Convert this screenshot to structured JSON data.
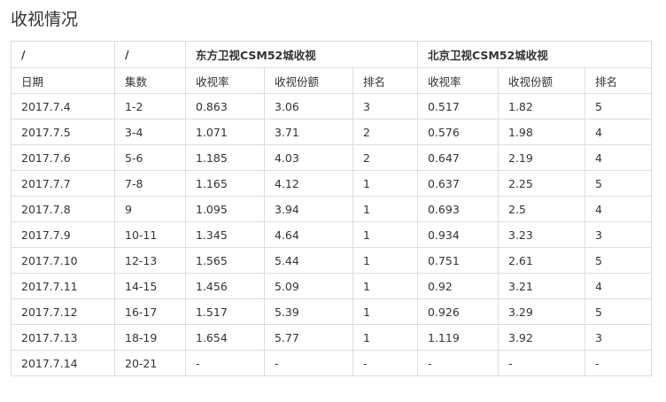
{
  "page": {
    "title": "收视情况"
  },
  "table": {
    "group_header": [
      "/",
      "/",
      "东方卫视CSM52城收视",
      "北京卫视CSM52城收视"
    ],
    "columns": [
      "日期",
      "集数",
      "收视率",
      "收视份额",
      "排名",
      "收视率",
      "收视份额",
      "排名"
    ],
    "rows": [
      [
        "2017.7.4",
        "1-2",
        "0.863",
        "3.06",
        "3",
        "0.517",
        "1.82",
        "5"
      ],
      [
        "2017.7.5",
        "3-4",
        "1.071",
        "3.71",
        "2",
        "0.576",
        "1.98",
        "4"
      ],
      [
        "2017.7.6",
        "5-6",
        "1.185",
        "4.03",
        "2",
        "0.647",
        "2.19",
        "4"
      ],
      [
        "2017.7.7",
        "7-8",
        "1.165",
        "4.12",
        "1",
        "0.637",
        "2.25",
        "5"
      ],
      [
        "2017.7.8",
        "9",
        "1.095",
        "3.94",
        "1",
        "0.693",
        "2.5",
        "4"
      ],
      [
        "2017.7.9",
        "10-11",
        "1.345",
        "4.64",
        "1",
        "0.934",
        "3.23",
        "3"
      ],
      [
        "2017.7.10",
        "12-13",
        "1.565",
        "5.44",
        "1",
        "0.751",
        "2.61",
        "5"
      ],
      [
        "2017.7.11",
        "14-15",
        "1.456",
        "5.09",
        "1",
        "0.92",
        "3.21",
        "4"
      ],
      [
        "2017.7.12",
        "16-17",
        "1.517",
        "5.39",
        "1",
        "0.926",
        "3.29",
        "5"
      ],
      [
        "2017.7.13",
        "18-19",
        "1.654",
        "5.77",
        "1",
        "1.119",
        "3.92",
        "3"
      ],
      [
        "2017.7.14",
        "20-21",
        "-",
        "-",
        "-",
        "-",
        "-",
        "-"
      ]
    ]
  }
}
